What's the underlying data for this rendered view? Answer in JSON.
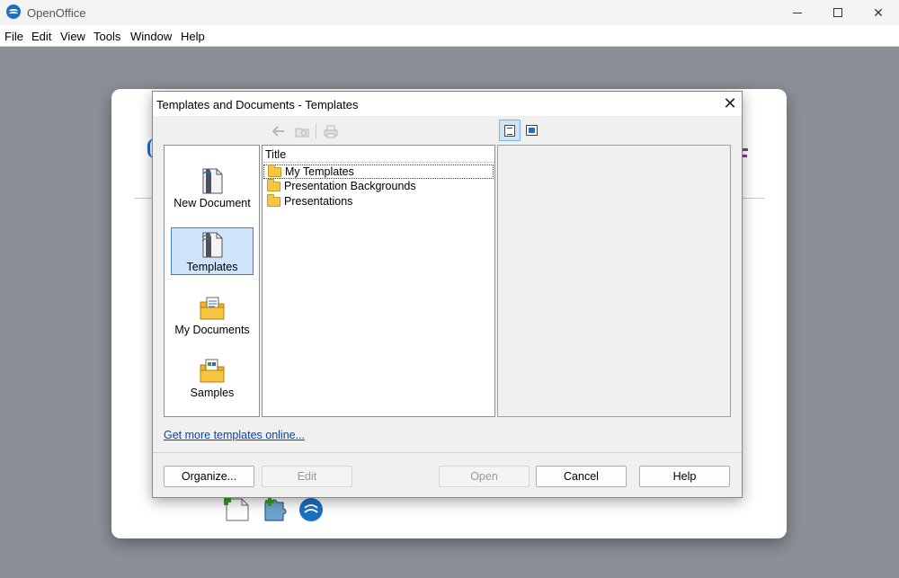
{
  "app": {
    "title": "OpenOffice",
    "menu": [
      "File",
      "Edit",
      "View",
      "Tools",
      "Window",
      "Help"
    ]
  },
  "dialog": {
    "title": "Templates and Documents - Templates",
    "nav": [
      {
        "label": "New Document",
        "icon": "new-document-icon"
      },
      {
        "label": "Templates",
        "icon": "templates-icon",
        "selected": true
      },
      {
        "label": "My Documents",
        "icon": "my-documents-icon"
      },
      {
        "label": "Samples",
        "icon": "samples-icon"
      }
    ],
    "list": {
      "header": "Title",
      "items": [
        "My Templates",
        "Presentation Backgrounds",
        "Presentations"
      ]
    },
    "link": "Get more templates online...",
    "buttons": {
      "organize": "Organize...",
      "edit": "Edit",
      "open": "Open",
      "cancel": "Cancel",
      "help": "Help"
    }
  },
  "colors": {
    "accent": "#3b82d6",
    "link": "#0645ad",
    "folder": "#f6c643"
  }
}
